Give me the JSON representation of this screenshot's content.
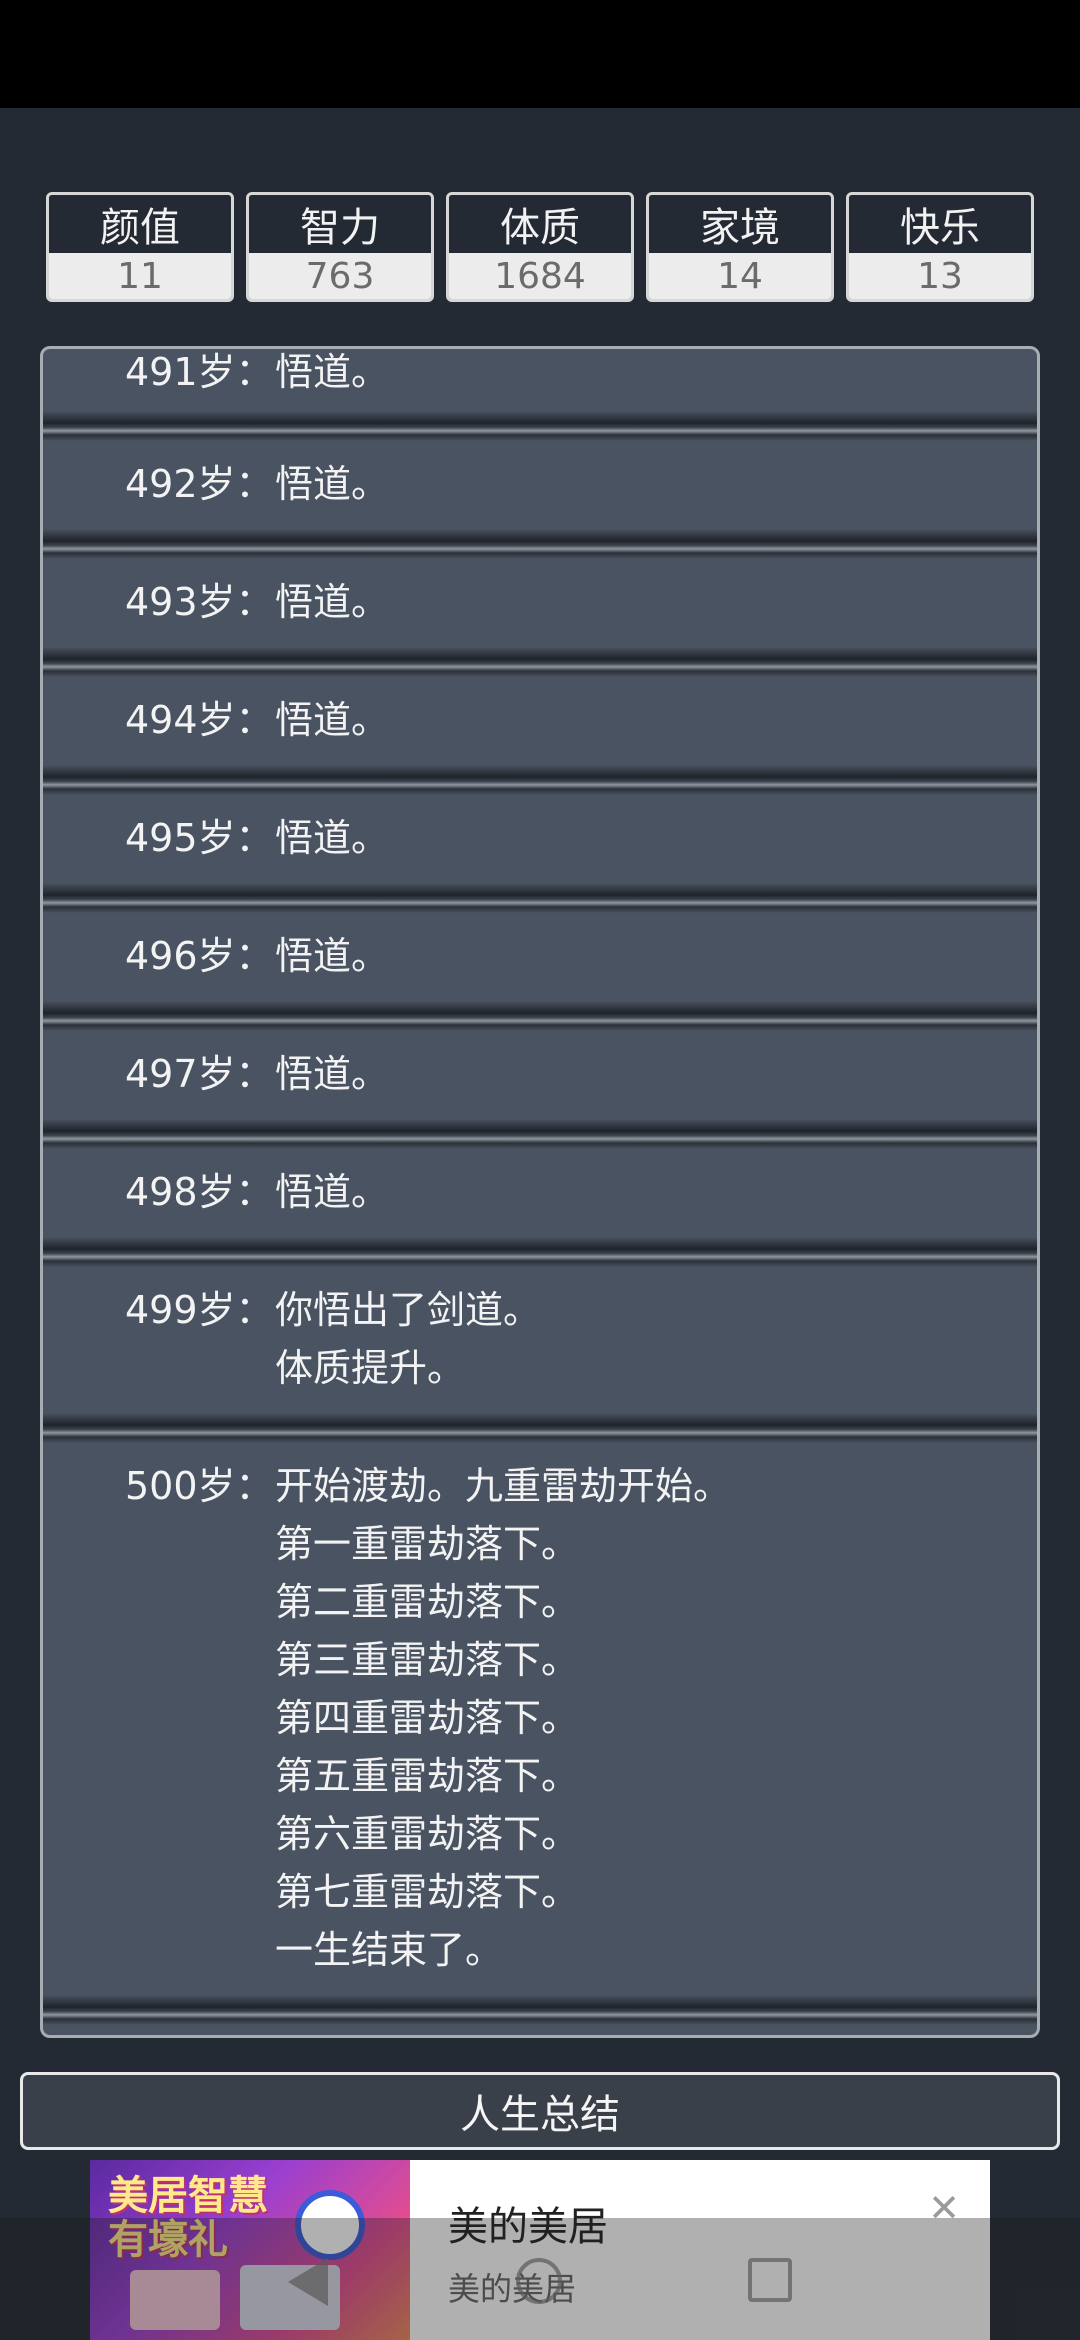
{
  "stats": [
    {
      "label": "颜值",
      "value": "11"
    },
    {
      "label": "智力",
      "value": "763"
    },
    {
      "label": "体质",
      "value": "1684"
    },
    {
      "label": "家境",
      "value": "14"
    },
    {
      "label": "快乐",
      "value": "13"
    }
  ],
  "log": [
    {
      "age": "491岁：",
      "text": "悟道。"
    },
    {
      "age": "492岁：",
      "text": "悟道。"
    },
    {
      "age": "493岁：",
      "text": "悟道。"
    },
    {
      "age": "494岁：",
      "text": "悟道。"
    },
    {
      "age": "495岁：",
      "text": "悟道。"
    },
    {
      "age": "496岁：",
      "text": "悟道。"
    },
    {
      "age": "497岁：",
      "text": "悟道。"
    },
    {
      "age": "498岁：",
      "text": "悟道。"
    },
    {
      "age": "499岁：",
      "text": "你悟出了剑道。\n体质提升。"
    },
    {
      "age": "500岁：",
      "text": "开始渡劫。九重雷劫开始。\n第一重雷劫落下。\n第二重雷劫落下。\n第三重雷劫落下。\n第四重雷劫落下。\n第五重雷劫落下。\n第六重雷劫落下。\n第七重雷劫落下。\n一生结束了。"
    }
  ],
  "summary_button": "人生总结",
  "ad": {
    "image_text": "美居智慧\n有壕礼",
    "title": "美的美居",
    "subtitle": "美的美居",
    "close_glyph": "✕"
  }
}
